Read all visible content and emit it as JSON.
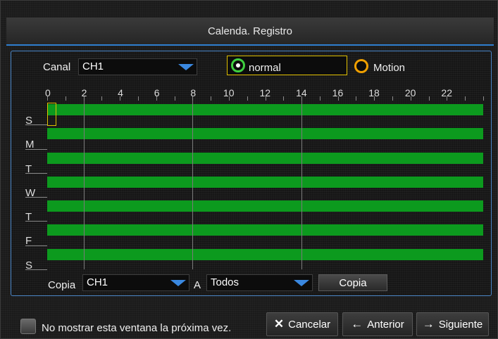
{
  "window": {
    "title": "Calenda. Registro"
  },
  "channel": {
    "label": "Canal",
    "value": "CH1"
  },
  "mode": {
    "normal_label": "normal",
    "motion_label": "Motion",
    "selected": "normal"
  },
  "schedule": {
    "hours": [
      "0",
      "2",
      "4",
      "6",
      "8",
      "10",
      "12",
      "14",
      "16",
      "18",
      "20",
      "22"
    ],
    "days": [
      "S",
      "M",
      "T",
      "W",
      "T",
      "F",
      "S"
    ],
    "record_color": "#0c9a1e"
  },
  "copy_row": {
    "copy_label": "Copia",
    "source_value": "CH1",
    "to_label": "A",
    "target_value": "Todos",
    "copy_button": "Copia"
  },
  "footer": {
    "checkbox_label": "No mostrar esta ventana la próxima vez.",
    "cancel_label": "Cancelar",
    "back_label": "Anterior",
    "next_label": "Siguiente"
  },
  "icons": {
    "cancel": "close-icon",
    "back": "arrow-left-icon",
    "next": "arrow-right-icon"
  }
}
